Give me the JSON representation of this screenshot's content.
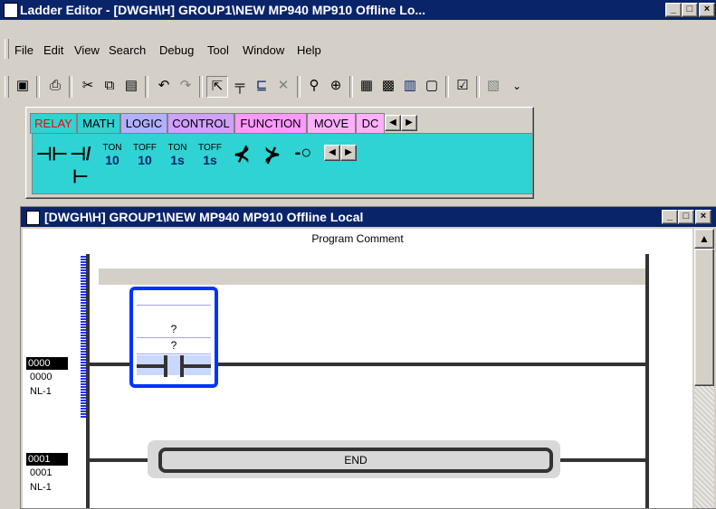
{
  "window": {
    "title": "Ladder Editor - [DWGH\\H]    GROUP1\\NEW  MP940  MP910     Offline  Lo...",
    "controls": {
      "minimize": "_",
      "maximize": "□",
      "close": "×"
    }
  },
  "menu": [
    "File",
    "Edit",
    "View",
    "Search",
    "Debug",
    "Tool",
    "Window",
    "Help"
  ],
  "toolbar": {
    "icons": [
      "save-icon",
      "print-icon",
      "cut-icon",
      "copy-icon",
      "paste-icon",
      "undo-icon",
      "redo-icon",
      "select-icon",
      "contact-tool-icon",
      "coil-tool-icon",
      "delete-tool-icon",
      "find-icon",
      "zoom-icon",
      "window-icon-1",
      "window-icon-2",
      "window-icon-3",
      "window-icon-4",
      "check-icon",
      "notes-icon"
    ]
  },
  "palette": {
    "tabs": [
      "RELAY",
      "MATH",
      "LOGIC",
      "CONTROL",
      "FUNCTION",
      "MOVE",
      "DC"
    ],
    "active_tab": "RELAY",
    "instructions": [
      {
        "name": "no-contact",
        "glyph": "⊣⊢"
      },
      {
        "name": "nc-contact",
        "glyph": "⊣/⊢"
      },
      {
        "name": "ton-10",
        "top": "TON",
        "bottom": "10"
      },
      {
        "name": "toff-10",
        "top": "TOFF",
        "bottom": "10"
      },
      {
        "name": "ton-1s",
        "top": "TON",
        "bottom": "1s"
      },
      {
        "name": "toff-1s",
        "top": "TOFF",
        "bottom": "1s"
      },
      {
        "name": "rising-edge",
        "glyph": "⊀"
      },
      {
        "name": "falling-edge",
        "glyph": "⊁"
      },
      {
        "name": "coil",
        "glyph": "-○"
      }
    ],
    "colors": {
      "body": "#2fd3d3",
      "relay_tab": "#ff0000",
      "math_tab": "#00a000",
      "logic_tab": "#6666ff",
      "control_tab": "#d0a0ff",
      "function_tab": "#ff99ff",
      "move_tab": "#ffb0ff"
    }
  },
  "child": {
    "title": "[DWGH\\H]    GROUP1\\NEW  MP940  MP910     Offline  Local",
    "program_comment": "Program Comment",
    "rungs": [
      {
        "tag": "0000",
        "line": "0000",
        "nl": "NL-1",
        "placeholders": [
          "?",
          "?"
        ]
      },
      {
        "tag": "0001",
        "line": "0001",
        "nl": "NL-1",
        "instruction": "END"
      }
    ],
    "colors": {
      "selection": "#0033ff",
      "accent": "#0a246a"
    }
  }
}
